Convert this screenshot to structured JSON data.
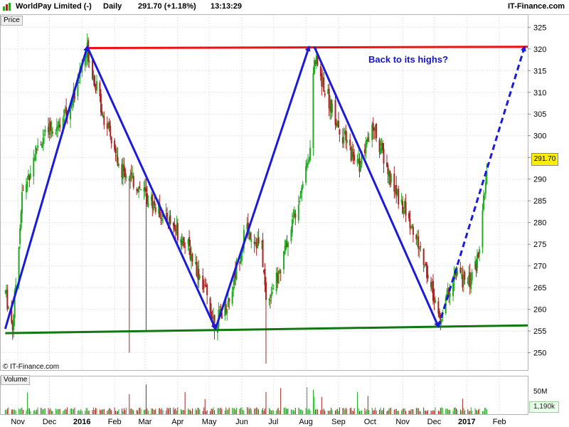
{
  "header": {
    "instrument": "WorldPay Limited (-)",
    "period": "Daily",
    "last_price": "291.70 (+1.18%)",
    "time": "13:13:29",
    "brand": "IT-Finance.com"
  },
  "panels": {
    "price_label": "Price",
    "volume_label": "Volume",
    "copyright": "© IT-Finance.com",
    "annotation": "Back to its highs?",
    "price_tag": "291.70",
    "volume_tag": "1,190k",
    "volume_axis_tick": "50M"
  },
  "colors": {
    "up_candle": "#22aa22",
    "down_candle": "#aa2222",
    "resistance": "#ee1111",
    "support": "#117711",
    "trend_arrows": "#1a1adb",
    "annotation": "#1414cc",
    "price_tag_bg": "#ffee00"
  },
  "chart_data": {
    "type": "candlestick",
    "title": "WorldPay Limited (-)",
    "xlabel": "",
    "ylabel": "",
    "y_range": [
      246,
      328
    ],
    "y_ticks": [
      250,
      255,
      260,
      265,
      270,
      275,
      280,
      285,
      290,
      295,
      300,
      305,
      310,
      315,
      320,
      325
    ],
    "x_range": [
      "2015-10-15",
      "2017-02-28"
    ],
    "x_ticks": [
      {
        "label": "Nov",
        "date": "2015-11-01"
      },
      {
        "label": "Dec",
        "date": "2015-12-01"
      },
      {
        "label": "2016",
        "date": "2016-01-01",
        "bold": true
      },
      {
        "label": "Feb",
        "date": "2016-02-01"
      },
      {
        "label": "Mar",
        "date": "2016-03-01"
      },
      {
        "label": "Apr",
        "date": "2016-04-01"
      },
      {
        "label": "May",
        "date": "2016-05-01"
      },
      {
        "label": "Jun",
        "date": "2016-06-01"
      },
      {
        "label": "Jul",
        "date": "2016-07-01"
      },
      {
        "label": "Aug",
        "date": "2016-08-01"
      },
      {
        "label": "Sep",
        "date": "2016-09-01"
      },
      {
        "label": "Oct",
        "date": "2016-10-01"
      },
      {
        "label": "Nov",
        "date": "2016-11-01"
      },
      {
        "label": "Dec",
        "date": "2016-12-01"
      },
      {
        "label": "2017",
        "date": "2017-01-01",
        "bold": true
      },
      {
        "label": "Feb",
        "date": "2017-02-01"
      }
    ],
    "grid": true,
    "trend_points": [
      {
        "date": "2015-10-20",
        "price": 264
      },
      {
        "date": "2015-10-27",
        "price": 256
      },
      {
        "date": "2015-11-05",
        "price": 286
      },
      {
        "date": "2015-11-20",
        "price": 298
      },
      {
        "date": "2015-12-05",
        "price": 302
      },
      {
        "date": "2015-12-20",
        "price": 306
      },
      {
        "date": "2016-01-06",
        "price": 320
      },
      {
        "date": "2016-01-20",
        "price": 306
      },
      {
        "date": "2016-02-05",
        "price": 293
      },
      {
        "date": "2016-02-25",
        "price": 288
      },
      {
        "date": "2016-03-10",
        "price": 284
      },
      {
        "date": "2016-03-25",
        "price": 280
      },
      {
        "date": "2016-04-10",
        "price": 275
      },
      {
        "date": "2016-04-25",
        "price": 266
      },
      {
        "date": "2016-05-06",
        "price": 257
      },
      {
        "date": "2016-05-20",
        "price": 262
      },
      {
        "date": "2016-06-05",
        "price": 279
      },
      {
        "date": "2016-06-20",
        "price": 274
      },
      {
        "date": "2016-06-24",
        "price": 262
      },
      {
        "date": "2016-07-05",
        "price": 267
      },
      {
        "date": "2016-07-20",
        "price": 281
      },
      {
        "date": "2016-08-05",
        "price": 297
      },
      {
        "date": "2016-08-09",
        "price": 318
      },
      {
        "date": "2016-08-20",
        "price": 310
      },
      {
        "date": "2016-09-05",
        "price": 300
      },
      {
        "date": "2016-09-20",
        "price": 293
      },
      {
        "date": "2016-10-05",
        "price": 302
      },
      {
        "date": "2016-10-20",
        "price": 290
      },
      {
        "date": "2016-11-05",
        "price": 282
      },
      {
        "date": "2016-11-20",
        "price": 272
      },
      {
        "date": "2016-12-01",
        "price": 263
      },
      {
        "date": "2016-12-06",
        "price": 257
      },
      {
        "date": "2016-12-20",
        "price": 268
      },
      {
        "date": "2017-01-05",
        "price": 266
      },
      {
        "date": "2017-01-12",
        "price": 272
      },
      {
        "date": "2017-01-20",
        "price": 291.7
      }
    ],
    "tall_wicks": [
      {
        "date": "2016-02-15",
        "low": 250
      },
      {
        "date": "2016-03-02",
        "low": 255
      },
      {
        "date": "2016-06-24",
        "low": 247.5
      },
      {
        "date": "2016-08-09",
        "high": 318
      }
    ],
    "lines": [
      {
        "name": "resistance",
        "from": {
          "date": "2016-01-06",
          "price": 320.2
        },
        "to": {
          "date": "2017-02-28",
          "price": 320.5
        }
      },
      {
        "name": "support",
        "from": {
          "date": "2015-10-20",
          "price": 254.5
        },
        "to": {
          "date": "2017-02-28",
          "price": 256.3
        }
      }
    ],
    "arrows": [
      {
        "from": {
          "date": "2015-10-20",
          "price": 255.5
        },
        "to": {
          "date": "2016-01-06",
          "price": 320.5
        },
        "style": "solid"
      },
      {
        "from": {
          "date": "2016-01-06",
          "price": 320.5
        },
        "to": {
          "date": "2016-05-07",
          "price": 255.5
        },
        "style": "solid"
      },
      {
        "from": {
          "date": "2016-05-07",
          "price": 255.5
        },
        "to": {
          "date": "2016-08-04",
          "price": 320.5
        },
        "style": "solid"
      },
      {
        "from": {
          "date": "2016-08-09",
          "price": 320.5
        },
        "to": {
          "date": "2016-12-05",
          "price": 256.0
        },
        "style": "solid"
      },
      {
        "from": {
          "date": "2016-12-05",
          "price": 256.0
        },
        "to": {
          "date": "2017-02-25",
          "price": 320.5
        },
        "style": "dashed"
      }
    ],
    "last_close": 291.7
  }
}
